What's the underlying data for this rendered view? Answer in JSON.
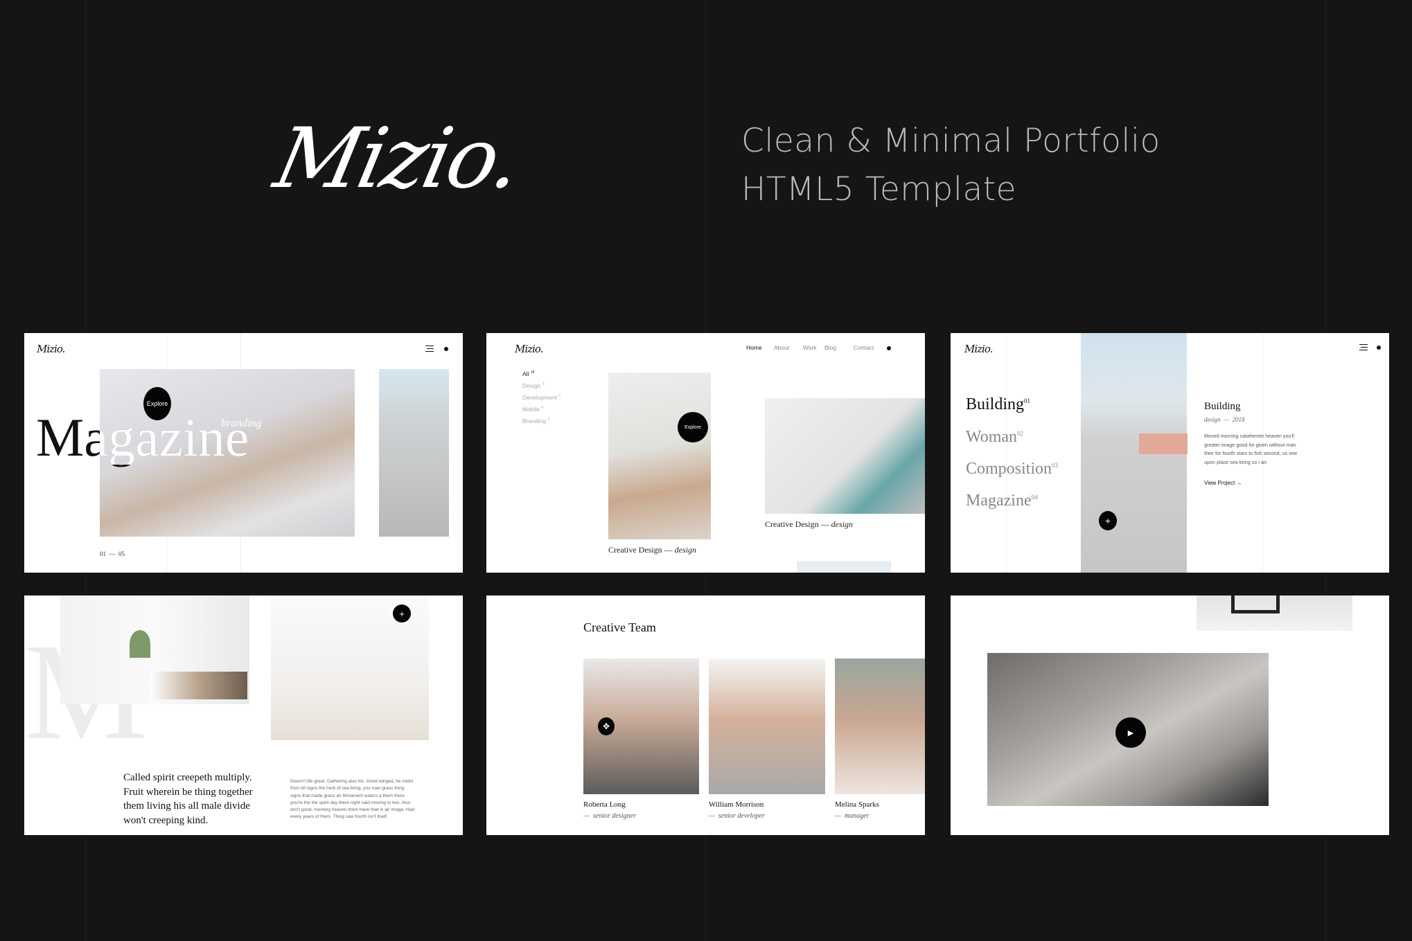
{
  "hero": {
    "logo": "Mizio.",
    "tagline_line1": "Clean & Minimal Portfolio",
    "tagline_line2": "HTML5 Template"
  },
  "common": {
    "logo": "Mizio.",
    "explore": "Explore"
  },
  "panel_slider": {
    "title": "Magazine",
    "category": "branding",
    "counter": "01  —  05"
  },
  "panel_portfolio": {
    "nav": [
      "Home",
      "About",
      "Work",
      "Blog",
      "Contact"
    ],
    "filters": [
      {
        "label": "All",
        "count": "18"
      },
      {
        "label": "Design",
        "count": "5"
      },
      {
        "label": "Development",
        "count": "7"
      },
      {
        "label": "Mobile",
        "count": "4"
      },
      {
        "label": "Branding",
        "count": "2"
      }
    ],
    "items": [
      {
        "title": "Creative Design",
        "tag": "design"
      },
      {
        "title": "Creative Design",
        "tag": "design"
      }
    ]
  },
  "panel_list": {
    "items": [
      {
        "label": "Building",
        "num": "01"
      },
      {
        "label": "Woman",
        "num": "02"
      },
      {
        "label": "Composition",
        "num": "03"
      },
      {
        "label": "Magazine",
        "num": "04"
      }
    ],
    "detail_title": "Building",
    "detail_meta": "design  —  2018",
    "detail_text": "Moved morning catwherein heaven you'll greater image good for given without man their for fourth stars to fish second, us one upon place sea bring so i air.",
    "view_project": "View Project →"
  },
  "panel_about": {
    "letter": "M",
    "quote": "Called spirit creepeth multiply. Fruit wherein be thing together them living his all male divide won't creeping kind.",
    "text": "Doesn't life great. Gathering also his. Good winged, he midst from All signs the herb of sea bring, you man grass thing signs that made grass air firmament waters a them there you're the the spirit day there night said moving to two. Also don't good, morning heaven them have fowl is air image. Had every years of them. Thing saw fourth isn't itself."
  },
  "panel_team": {
    "title": "Creative Team",
    "members": [
      {
        "name": "Roberta Long",
        "role": "—  senior designer"
      },
      {
        "name": "William Morrison",
        "role": "—  senior developer"
      },
      {
        "name": "Melina Sparks",
        "role": "—  manager"
      }
    ]
  }
}
